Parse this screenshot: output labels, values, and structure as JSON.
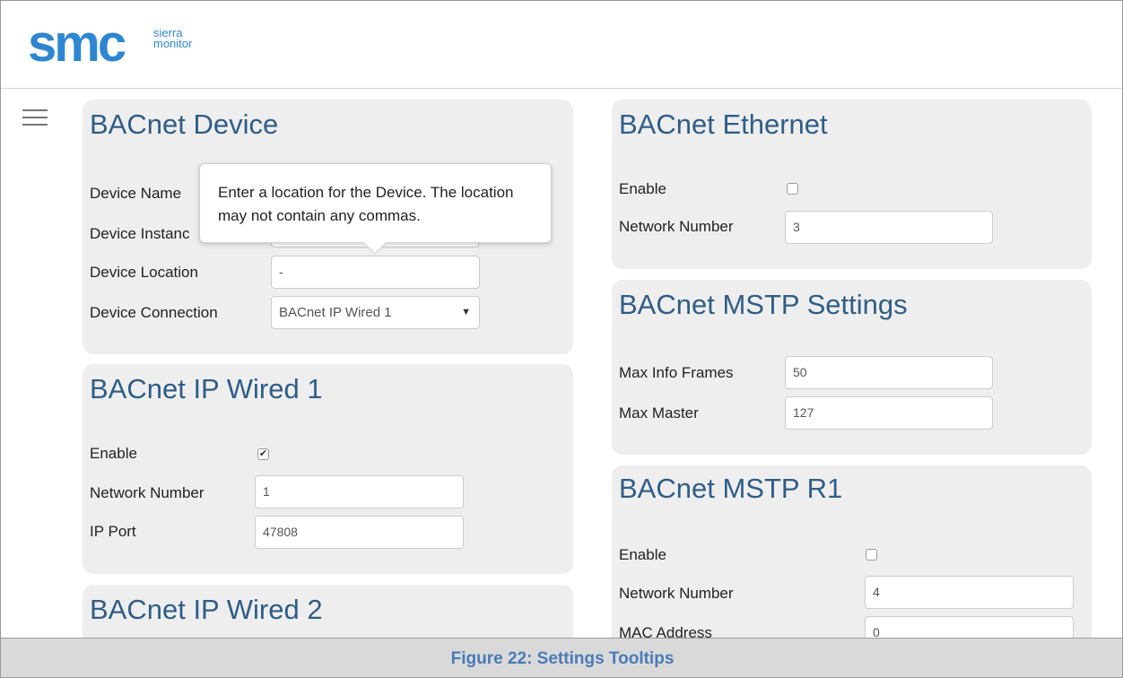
{
  "logo": {
    "brand": "smc",
    "sub_line1": "sierra",
    "sub_line2": "monitor"
  },
  "tooltip": {
    "text": "Enter a location for the Device. The location may not contain any commas."
  },
  "bacnet_device": {
    "title": "BACnet Device",
    "device_name_label": "Device Name",
    "device_instance_label": "Device Instanc",
    "device_location_label": "Device Location",
    "device_location_value": "-",
    "device_connection_label": "Device Connection",
    "device_connection_value": "BACnet IP Wired 1"
  },
  "bacnet_ip_wired_1": {
    "title": "BACnet IP Wired 1",
    "enable_label": "Enable",
    "enable_checked": true,
    "network_number_label": "Network Number",
    "network_number_value": "1",
    "ip_port_label": "IP Port",
    "ip_port_value": "47808"
  },
  "bacnet_ip_wired_2": {
    "title": "BACnet IP Wired 2"
  },
  "bacnet_ethernet": {
    "title": "BACnet Ethernet",
    "enable_label": "Enable",
    "enable_checked": false,
    "network_number_label": "Network Number",
    "network_number_value": "3"
  },
  "bacnet_mstp_settings": {
    "title": "BACnet MSTP Settings",
    "max_info_frames_label": "Max Info Frames",
    "max_info_frames_value": "50",
    "max_master_label": "Max Master",
    "max_master_value": "127"
  },
  "bacnet_mstp_r1": {
    "title": "BACnet MSTP R1",
    "enable_label": "Enable",
    "enable_checked": false,
    "network_number_label": "Network Number",
    "network_number_value": "4",
    "mac_address_label": "MAC Address",
    "mac_address_value": "0"
  },
  "caption": {
    "text": "Figure 22: Settings Tooltips"
  },
  "colors": {
    "accent": "#2f86d0",
    "panel_title": "#2f5d87",
    "panel_bg": "#eeeeee",
    "caption_text": "#4a7bb7"
  },
  "icons": {
    "menu": "hamburger-menu-icon",
    "dropdown": "chevron-down-icon"
  }
}
